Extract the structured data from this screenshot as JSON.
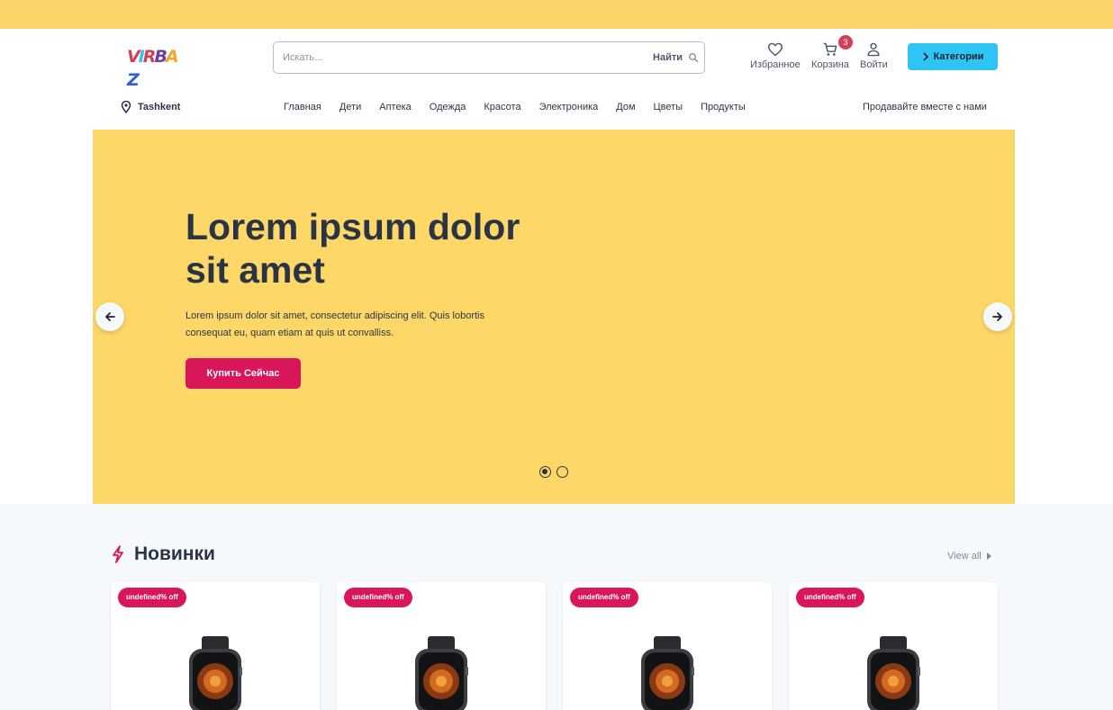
{
  "header": {
    "logo_text": "VIRBAZ",
    "search": {
      "placeholder": "Искать...",
      "button_label": "Найти"
    },
    "favorites_label": "Избранное",
    "cart_label": "Корзина",
    "cart_count": "3",
    "login_label": "Войти",
    "categories_label": "Категории",
    "location": "Tashkent",
    "nav_items": [
      "Главная",
      "Дети",
      "Аптека",
      "Одежда",
      "Красота",
      "Электроника",
      "Дом",
      "Цветы",
      "Продукты"
    ],
    "sell_link": "Продавайте вместе с нами"
  },
  "hero": {
    "title": "Lorem ipsum dolor sit amet",
    "text": "Lorem ipsum dolor sit amet, consectetur adipiscing elit. Quis lobortis consequat eu, quam etiam at quis ut convalliss.",
    "button_label": "Купить Сейчас",
    "slides": 2,
    "active_slide": 1
  },
  "new_section": {
    "title": "Новинки",
    "view_all": "View all",
    "products": [
      {
        "discount_label": "undefined% off"
      },
      {
        "discount_label": "undefined% off"
      },
      {
        "discount_label": "undefined% off"
      },
      {
        "discount_label": "undefined% off"
      }
    ]
  },
  "colors": {
    "topbar": "#fcd56a",
    "hero_bg": "#fdd767",
    "primary": "#d9165a",
    "categories_button": "#2ec4f3"
  }
}
